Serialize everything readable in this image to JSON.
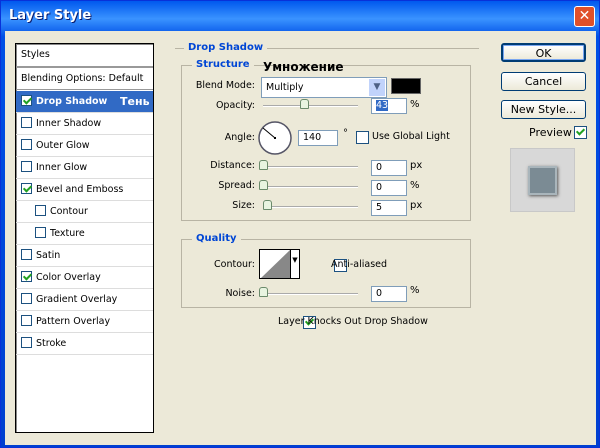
{
  "window": {
    "title": "Layer Style",
    "close": "✕"
  },
  "sidebar": {
    "header": "Styles",
    "items": [
      {
        "label": "Blending Options: Default",
        "checkbox": false
      },
      {
        "label": "Drop Shadow",
        "checked": true,
        "selected": true
      },
      {
        "label": "Inner Shadow",
        "checked": false
      },
      {
        "label": "Outer Glow",
        "checked": false
      },
      {
        "label": "Inner Glow",
        "checked": false
      },
      {
        "label": "Bevel and Emboss",
        "checked": true
      },
      {
        "label": "Contour",
        "checked": false,
        "indent": true
      },
      {
        "label": "Texture",
        "checked": false,
        "indent": true
      },
      {
        "label": "Satin",
        "checked": false
      },
      {
        "label": "Color Overlay",
        "checked": true
      },
      {
        "label": "Gradient Overlay",
        "checked": false
      },
      {
        "label": "Pattern Overlay",
        "checked": false
      },
      {
        "label": "Stroke",
        "checked": false
      }
    ]
  },
  "annotations": {
    "blend_ru": "Умножение",
    "shadow_ru": "Тень"
  },
  "panel": {
    "title": "Drop Shadow",
    "structure": {
      "title": "Structure",
      "blend_mode_label": "Blend Mode:",
      "blend_mode": "Multiply",
      "color": "#000000",
      "opacity_label": "Opacity:",
      "opacity": "43",
      "opacity_unit": "%",
      "angle_label": "Angle:",
      "angle": "140",
      "angle_unit": "°",
      "global_light_label": "Use Global Light",
      "global_light": false,
      "distance_label": "Distance:",
      "distance": "0",
      "distance_unit": "px",
      "spread_label": "Spread:",
      "spread": "0",
      "spread_unit": "%",
      "size_label": "Size:",
      "size": "5",
      "size_unit": "px"
    },
    "quality": {
      "title": "Quality",
      "contour_label": "Contour:",
      "antialiased_label": "Anti-aliased",
      "antialiased": false,
      "noise_label": "Noise:",
      "noise": "0",
      "noise_unit": "%"
    },
    "knockout_label": "Layer Knocks Out Drop Shadow",
    "knockout": true
  },
  "buttons": {
    "ok": "OK",
    "cancel": "Cancel",
    "new_style": "New Style...",
    "preview_label": "Preview",
    "preview": true
  }
}
